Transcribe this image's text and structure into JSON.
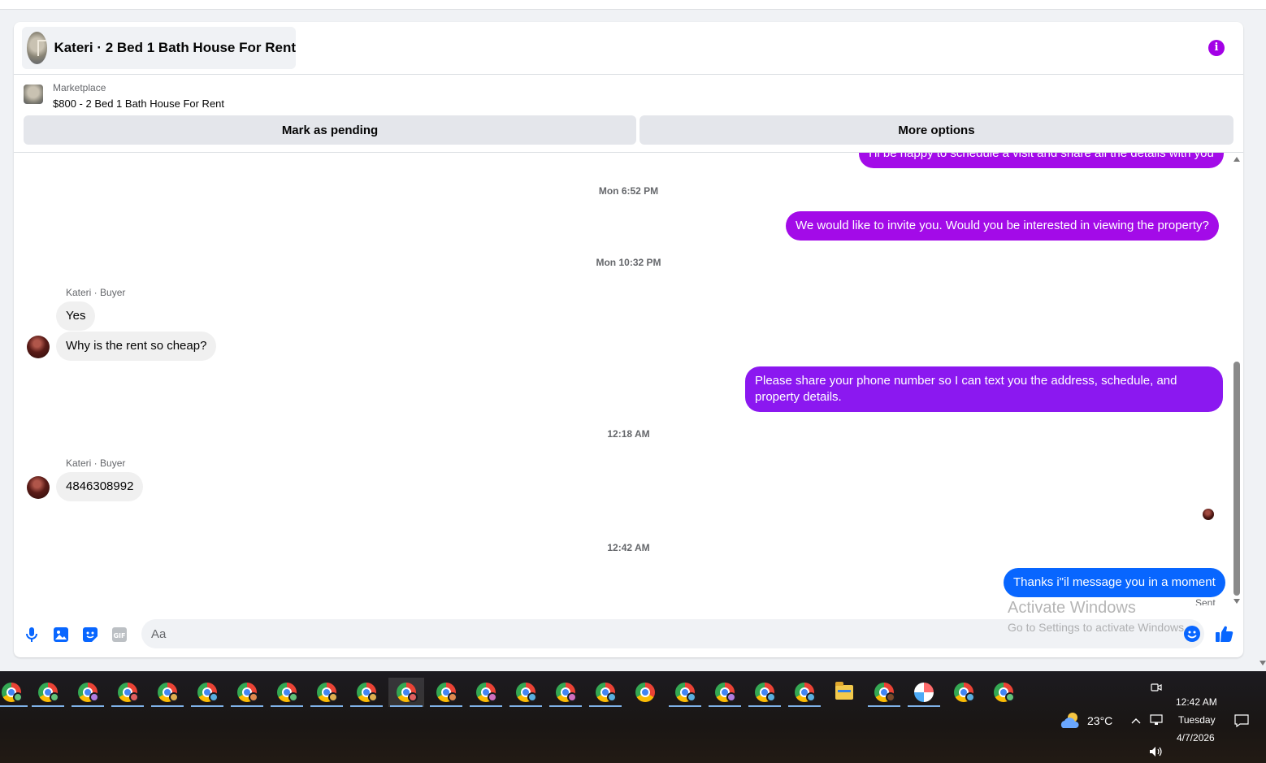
{
  "header": {
    "title": "Kateri · 2 Bed 1 Bath House For Rent"
  },
  "listing": {
    "label": "Marketplace",
    "price_title": "$800 - 2 Bed 1 Bath House For Rent",
    "mark_pending_label": "Mark as pending",
    "more_options_label": "More options"
  },
  "messages": {
    "m0_text": "I'll be happy to schedule a visit and share all the details with you",
    "t1": "Mon 6:52 PM",
    "m1_text": "We would like to invite you. Would you be interested in viewing the property?",
    "t2": "Mon 10:32 PM",
    "sender1": "Kateri · Buyer",
    "m2_text": "Yes",
    "m3_text": "Why is the rent so cheap?",
    "m4_text": "Please share your phone number so I can text you the address, schedule, and property details.",
    "t3": "12:18 AM",
    "sender2": "Kateri · Buyer",
    "m5_text": "4846308992",
    "t4": "12:42 AM",
    "m6_text": "Thanks i\"il message you in a moment",
    "status": "Sent"
  },
  "composer": {
    "placeholder": "Aa"
  },
  "watermark": {
    "line1": "Activate Windows",
    "line2": "Go to Settings to activate Windows."
  },
  "taskbar": {
    "icons": [
      "chrome-icon",
      "folder-icon",
      "snipping-tool-icon"
    ],
    "weather": "23°C",
    "time": "12:42 AM",
    "day": "Tuesday",
    "date": "4/7/2026"
  },
  "colors": {
    "accent_purple": "#a30be8",
    "accent_violet": "#8b18f0",
    "accent_blue": "#0866ff",
    "info_icon": "#a300e6"
  }
}
